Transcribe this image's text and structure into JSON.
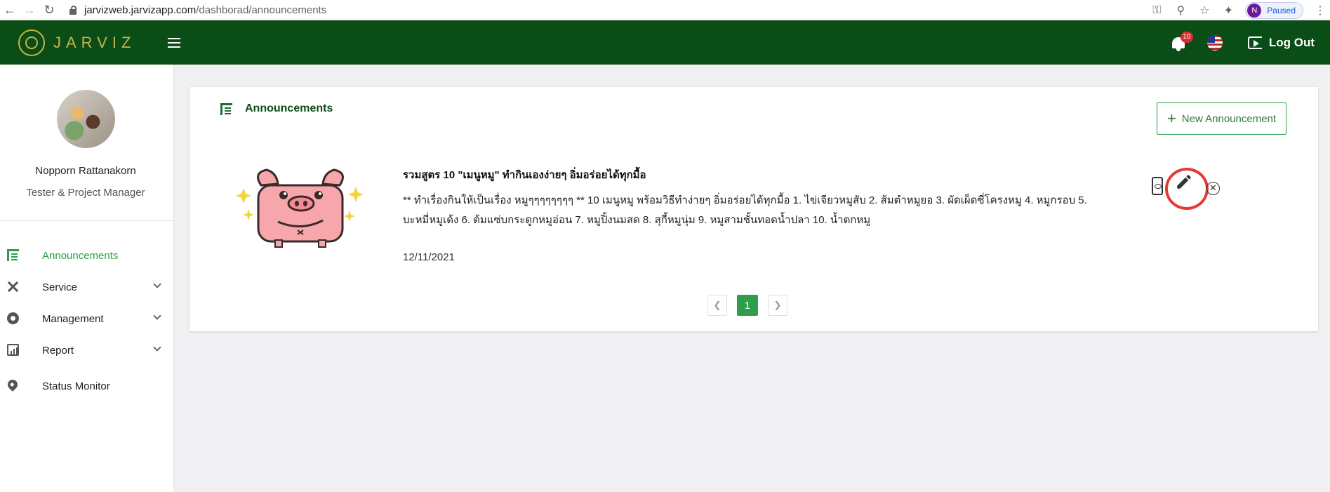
{
  "browser": {
    "url_host": "jarvizweb.jarvizapp.com",
    "url_path": "/dashborad/announcements",
    "profile_initial": "N",
    "profile_status": "Paused"
  },
  "header": {
    "brand": "JARVIZ",
    "notification_count": "10",
    "logout_label": "Log Out",
    "theme_color": "#0b4d17"
  },
  "sidebar": {
    "user_name": "Nopporn Rattanakorn",
    "user_role": "Tester & Project Manager",
    "items": [
      {
        "label": "Announcements",
        "icon": "announcements-icon",
        "active": true
      },
      {
        "label": "Service",
        "icon": "tools-icon",
        "expandable": true
      },
      {
        "label": "Management",
        "icon": "gear-icon",
        "expandable": true
      },
      {
        "label": "Report",
        "icon": "report-icon",
        "expandable": true
      },
      {
        "label": "Status Monitor",
        "icon": "location-pin-icon"
      }
    ]
  },
  "main": {
    "title": "Announcements",
    "new_button_label": "New Announcement",
    "announcement": {
      "title": "รวมสูตร 10 \"เมนูหมู\" ทำกินเองง่ายๆ อิ่มอร่อยได้ทุกมื้อ",
      "body": "** ทำเรื่องกินให้เป็นเรื่อง หมูๆๆๆๆๆๆๆๆ ** 10 เมนูหมู พร้อมวิธีทำง่ายๆ อิ่มอร่อยได้ทุกมื้อ 1. ไข่เจียวหมูสับ 2. ส้มตำหมูยอ 3. ผัดเผ็ดซี่โครงหมู 4. หมูกรอบ 5. บะหมี่หมูเด้ง 6. ต้มแซ่บกระดูกหมูอ่อน 7. หมูปิ้งนมสด 8. สุกี้หมูนุ่ม 9. หมูสามชั้นทอดน้ำปลา 10. น้ำตกหมู",
      "date": "12/11/2021"
    },
    "pagination": {
      "current_page": "1"
    },
    "accent_color": "#2e9e4a"
  }
}
